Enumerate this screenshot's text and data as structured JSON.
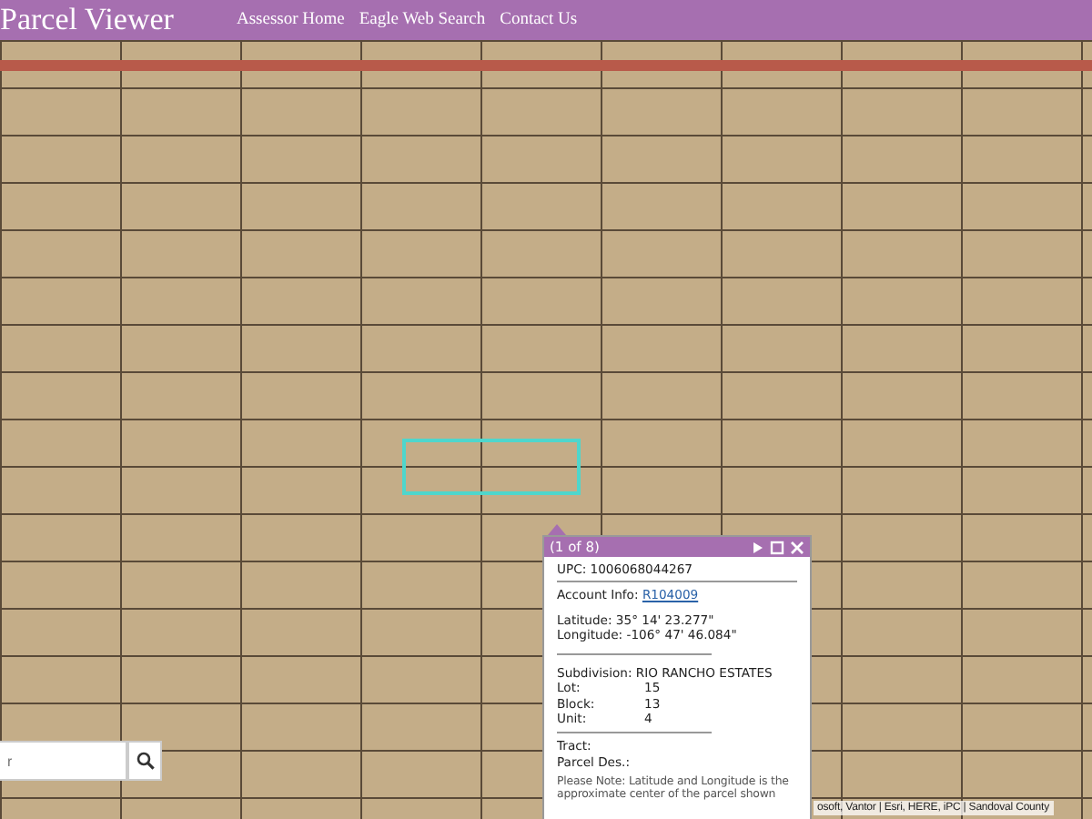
{
  "header": {
    "title": "Parcel Viewer",
    "links": [
      "Assessor Home",
      "Eagle Web Search",
      "Contact Us"
    ]
  },
  "popup": {
    "title": "(1 of 8)",
    "upc": "UPC: 1006068044267",
    "account_label": "Account Info:",
    "account_link": "R104009",
    "latitude": "Latitude: 35° 14' 23.277\"",
    "longitude": "Longitude: -106° 47' 46.084\"",
    "subdivision": "Subdivision: RIO RANCHO ESTATES",
    "fields": [
      {
        "label": "Lot:",
        "value": "15"
      },
      {
        "label": "Block:",
        "value": "13"
      },
      {
        "label": "Unit:",
        "value": "4"
      }
    ],
    "tract": "Tract:",
    "parcel_des": "Parcel Des.:",
    "note": "Please Note: Latitude and Longitude is the approximate center of the parcel shown"
  },
  "search": {
    "placeholder": "r"
  },
  "attribution": "osoft, Vantor | Esri, HERE, iPC | Sandoval County"
}
